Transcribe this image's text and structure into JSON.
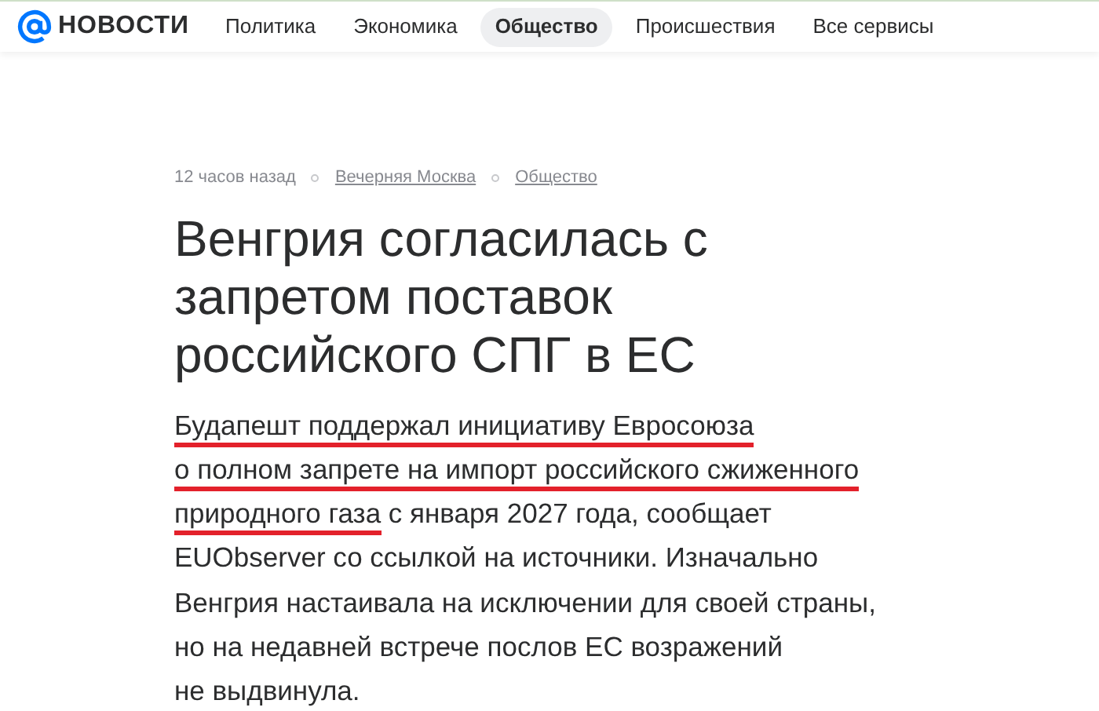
{
  "logo": {
    "text": "НОВОСТИ"
  },
  "nav": [
    {
      "label": "Политика",
      "selected": false
    },
    {
      "label": "Экономика",
      "selected": false
    },
    {
      "label": "Общество",
      "selected": true
    },
    {
      "label": "Происшествия",
      "selected": false
    },
    {
      "label": "Все сервисы",
      "selected": false
    }
  ],
  "meta": {
    "time": "12 часов назад",
    "source": "Вечерняя Москва",
    "category": "Общество"
  },
  "title": "Венгрия согласилась с запретом поставок российского СПГ в ЕС",
  "lines": [
    [
      {
        "text": "Будапешт поддержал инициативу Евросоюза",
        "underlined": true
      }
    ],
    [
      {
        "text": "о полном запрете на импорт российского сжиженного",
        "underlined": true
      }
    ],
    [
      {
        "text": "природного газа",
        "underlined": true
      },
      {
        "text": " с января 2027 года, сообщает",
        "underlined": false
      }
    ],
    [
      {
        "text": "EUObserver со ссылкой на источники. Изначально",
        "underlined": false
      }
    ],
    [
      {
        "text": "Венгрия настаивала на исключении для своей страны,",
        "underlined": false
      }
    ],
    [
      {
        "text": "но на недавней встрече послов ЕС возражений",
        "underlined": false
      }
    ],
    [
      {
        "text": "не выдвинула.",
        "underlined": false
      }
    ]
  ]
}
